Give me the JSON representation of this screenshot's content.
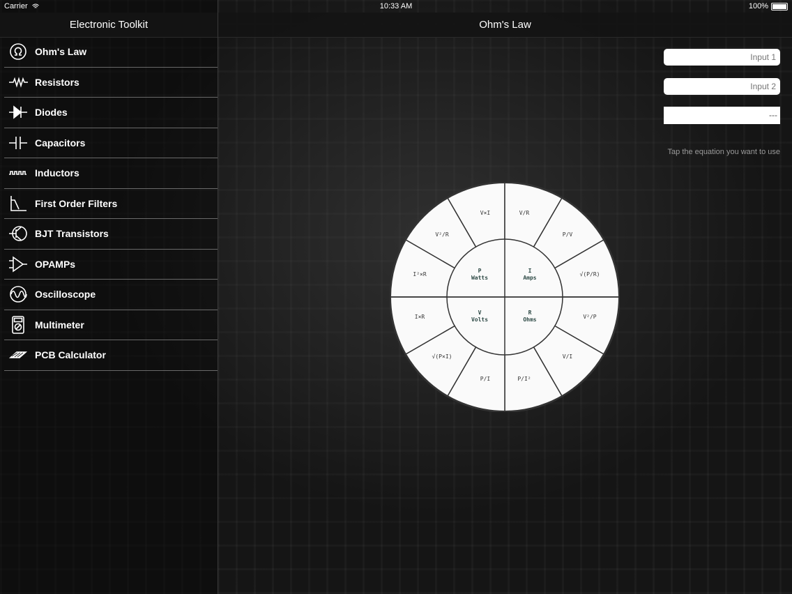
{
  "status_bar": {
    "carrier": "Carrier",
    "time": "10:33 AM",
    "battery": "100%"
  },
  "sidebar": {
    "title": "Electronic Toolkit",
    "items": [
      {
        "label": "Ohm's Law",
        "icon": "ohm-icon"
      },
      {
        "label": "Resistors",
        "icon": "resistor-icon"
      },
      {
        "label": "Diodes",
        "icon": "diode-icon"
      },
      {
        "label": "Capacitors",
        "icon": "capacitor-icon"
      },
      {
        "label": "Inductors",
        "icon": "inductor-icon"
      },
      {
        "label": "First Order Filters",
        "icon": "filter-icon"
      },
      {
        "label": "BJT Transistors",
        "icon": "transistor-icon"
      },
      {
        "label": "OPAMPs",
        "icon": "opamp-icon"
      },
      {
        "label": "Oscilloscope",
        "icon": "oscilloscope-icon"
      },
      {
        "label": "Multimeter",
        "icon": "multimeter-icon"
      },
      {
        "label": "PCB Calculator",
        "icon": "pcb-icon"
      }
    ]
  },
  "main": {
    "title": "Ohm's Law",
    "input1_placeholder": "Input 1",
    "input2_placeholder": "Input 2",
    "result": "---",
    "hint": "Tap the equation you want to use"
  },
  "wheel": {
    "core": {
      "p": {
        "symbol": "P",
        "unit": "Watts"
      },
      "i": {
        "symbol": "I",
        "unit": "Amps"
      },
      "v": {
        "symbol": "V",
        "unit": "Volts"
      },
      "r": {
        "symbol": "R",
        "unit": "Ohms"
      }
    },
    "outer": {
      "p_vi": "V×I",
      "p_v2r": "V²/R",
      "p_i2r": "I²×R",
      "i_vr": "V/R",
      "i_pv": "P/V",
      "i_sqrt_pr": "√(P/R)",
      "r_v2p": "V²/P",
      "r_vi": "V/I",
      "r_pi2": "P/I²",
      "v_pi": "P/I",
      "v_sqrt_pr": "√(P×I)",
      "v_ir": "I×R"
    }
  },
  "colors": {
    "wheel_fill": "#fafafa",
    "wheel_stroke": "#333333",
    "core_text": "#2e4a46",
    "hint_text": "#9a9a9a"
  }
}
